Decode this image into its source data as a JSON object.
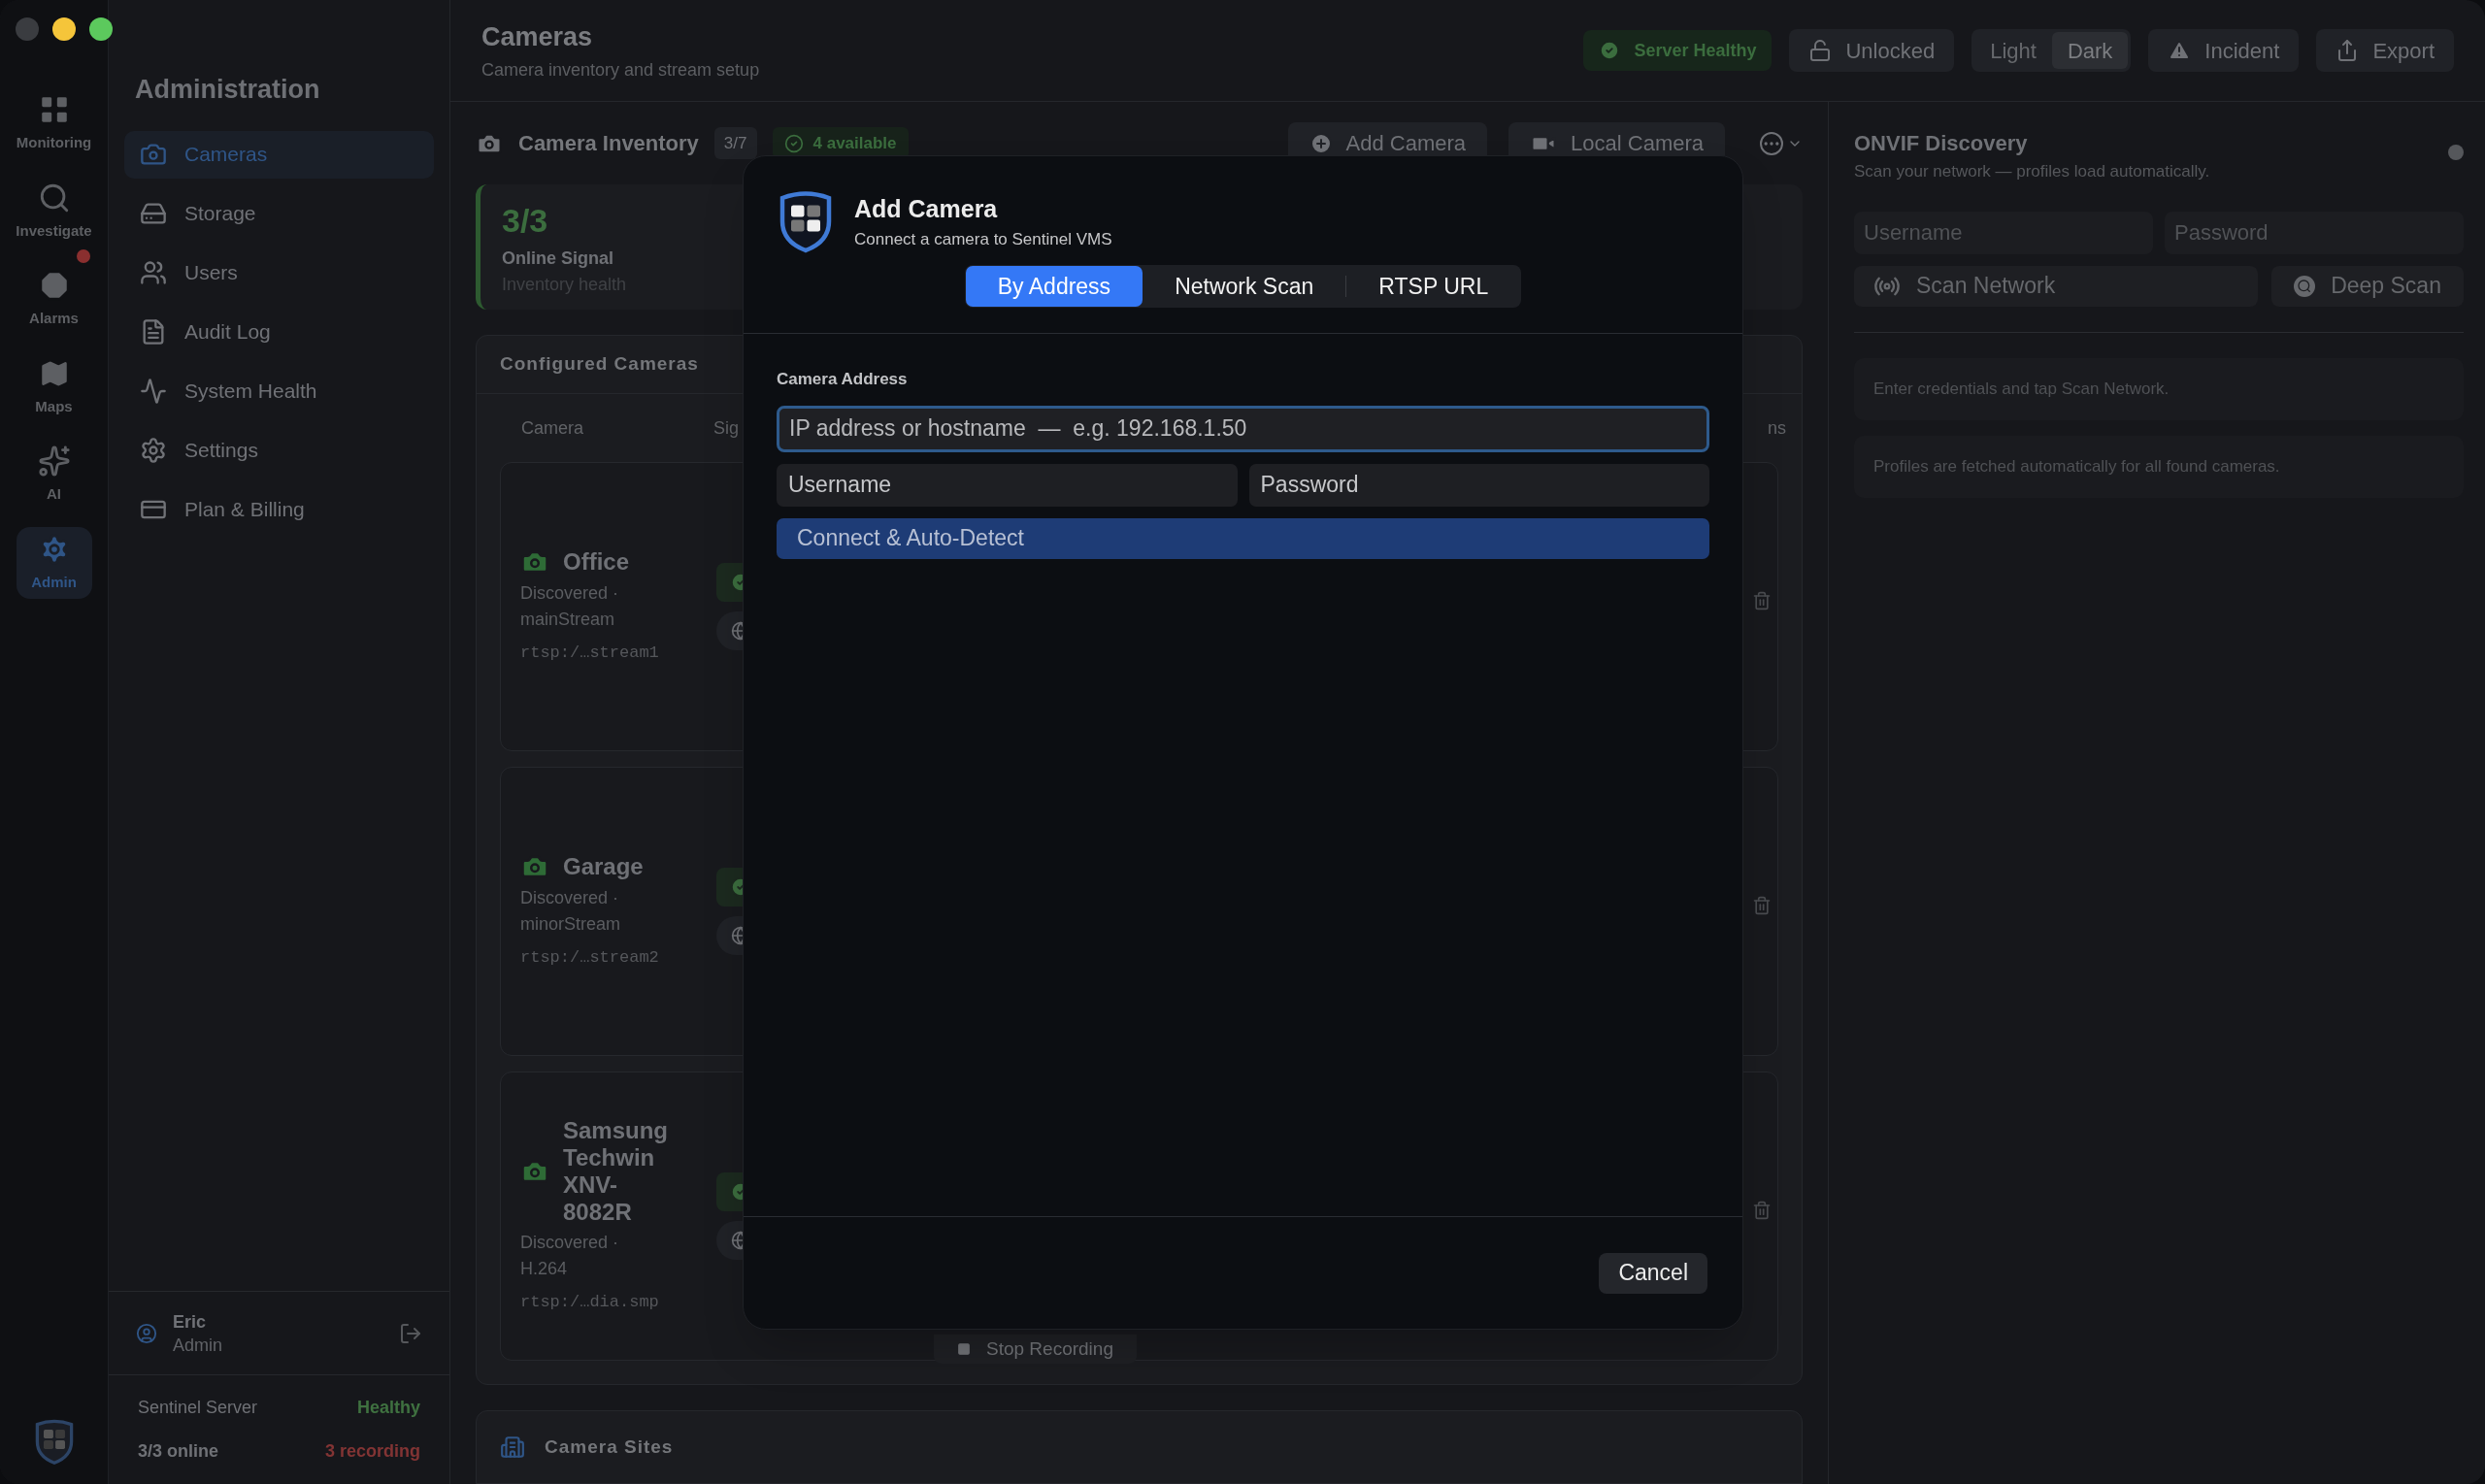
{
  "rail": [
    {
      "label": "Monitoring",
      "selected": false,
      "alert": false
    },
    {
      "label": "Investigate",
      "selected": false,
      "alert": false
    },
    {
      "label": "Alarms",
      "selected": false,
      "alert": true
    },
    {
      "label": "Maps",
      "selected": false,
      "alert": false
    },
    {
      "label": "AI",
      "selected": false,
      "alert": false
    },
    {
      "label": "Admin",
      "selected": true,
      "alert": false
    }
  ],
  "sidebar": {
    "title": "Administration",
    "items": [
      {
        "label": "Cameras",
        "selected": true
      },
      {
        "label": "Storage",
        "selected": false
      },
      {
        "label": "Users",
        "selected": false
      },
      {
        "label": "Audit Log",
        "selected": false
      },
      {
        "label": "System Health",
        "selected": false
      },
      {
        "label": "Settings",
        "selected": false
      },
      {
        "label": "Plan & Billing",
        "selected": false
      }
    ],
    "user": {
      "name": "Eric",
      "role": "Admin"
    },
    "status": {
      "server_label": "Sentinel Server",
      "server_status": "Healthy",
      "online": "3/3 online",
      "recording": "3 recording"
    }
  },
  "header": {
    "title": "Cameras",
    "subtitle": "Camera inventory and stream setup"
  },
  "toolbar": {
    "health": "Server Healthy",
    "lock": "Unlocked",
    "theme": [
      {
        "label": "Light",
        "selected": false
      },
      {
        "label": "Dark",
        "selected": true
      }
    ],
    "incident": "Incident",
    "export": "Export"
  },
  "inventory": {
    "title": "Camera Inventory",
    "count": "3/7",
    "available": "4 available",
    "add": "Add Camera",
    "local": "Local Camera"
  },
  "stat": {
    "value": "3/3",
    "label": "Online Signal",
    "caption": "Inventory health"
  },
  "configured": {
    "title": "Configured Cameras",
    "columns": [
      "Camera",
      "Sig",
      "ns"
    ],
    "rows": [
      {
        "name": "Office",
        "detail": "Discovered · mainStream",
        "url": "rtsp:/…stream1"
      },
      {
        "name": "Garage",
        "detail": "Discovered · minorStream",
        "url": "rtsp:/…stream2"
      },
      {
        "name": "Samsung Techwin XNV-8082R",
        "detail": "Discovered · H.264",
        "url": "rtsp:/…dia.smp"
      }
    ],
    "stop": "Stop Recording"
  },
  "sites": {
    "title": "Camera Sites"
  },
  "modal": {
    "title": "Add Camera",
    "subtitle": "Connect a camera to Sentinel VMS",
    "tabs": [
      {
        "label": "By Address",
        "selected": true
      },
      {
        "label": "Network Scan",
        "selected": false
      },
      {
        "label": "RTSP URL",
        "selected": false
      }
    ],
    "section": "Camera Address",
    "address": {
      "placeholder": "IP address or hostname  —  e.g. 192.168.1.50"
    },
    "username": {
      "placeholder": "Username"
    },
    "password": {
      "placeholder": "Password"
    },
    "connect": "Connect & Auto-Detect",
    "cancel": "Cancel"
  },
  "onvif": {
    "title": "ONVIF Discovery",
    "subtitle": "Scan your network — profiles load automatically.",
    "username": {
      "placeholder": "Username"
    },
    "password": {
      "placeholder": "Password"
    },
    "scan": "Scan Network",
    "deep": "Deep Scan",
    "notes": [
      "Enter credentials and tap Scan Network.",
      "Profiles are fetched automatically for all found cameras."
    ]
  }
}
